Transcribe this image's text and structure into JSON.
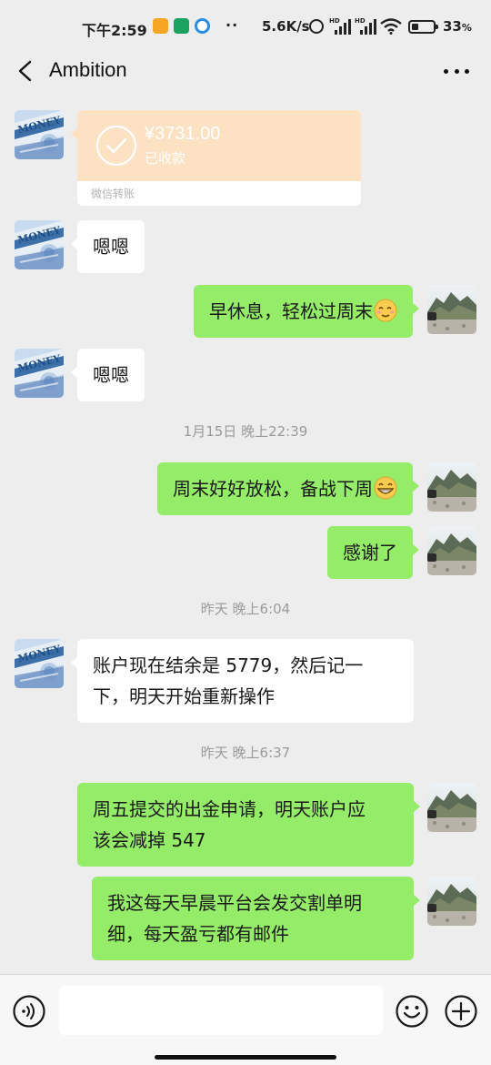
{
  "status_bar": {
    "time": "下午2:59",
    "dots": "··",
    "net_speed": "5.6K/s",
    "battery_level": 0.33,
    "battery_text": "33",
    "battery_unit": "%",
    "hd_label": "HD"
  },
  "nav": {
    "title": "Ambition",
    "back_icon": "chevron-left-icon",
    "more_icon": "more-dots-icon"
  },
  "transfer": {
    "amount": "¥3731.00",
    "status": "已收款",
    "label": "微信转账",
    "icon": "check-circle-icon"
  },
  "messages": [
    {
      "side": "left",
      "text": "嗯嗯"
    },
    {
      "side": "right",
      "text": "早休息，轻松过周末",
      "emoji": "relieved-face-emoji"
    },
    {
      "side": "left",
      "text": "嗯嗯"
    },
    {
      "side": "right",
      "text": "周末好好放松，备战下周",
      "emoji": "grinning-face-emoji"
    },
    {
      "side": "right",
      "text": "感谢了"
    },
    {
      "side": "left",
      "lines": [
        "账户现在结余是 5779，然后记一",
        "下，明天开始重新操作"
      ]
    },
    {
      "side": "right",
      "lines": [
        "周五提交的出金申请，明天账户应",
        "该会减掉 547"
      ]
    },
    {
      "side": "right",
      "lines": [
        "我这每天早晨平台会发交割单明",
        "细，每天盈亏都有邮件"
      ]
    }
  ],
  "timestamps": [
    "1月15日 晚上22:39",
    "昨天 晚上6:04",
    "昨天 晚上6:37"
  ],
  "input_bar": {
    "placeholder": "",
    "voice_icon": "voice-icon",
    "emoji_icon": "smiley-icon",
    "plus_icon": "plus-icon"
  },
  "colors": {
    "background": "#ededed",
    "outgoing_bubble": "#95ec69",
    "incoming_bubble": "#ffffff",
    "transfer_card": "#fde1c3"
  }
}
